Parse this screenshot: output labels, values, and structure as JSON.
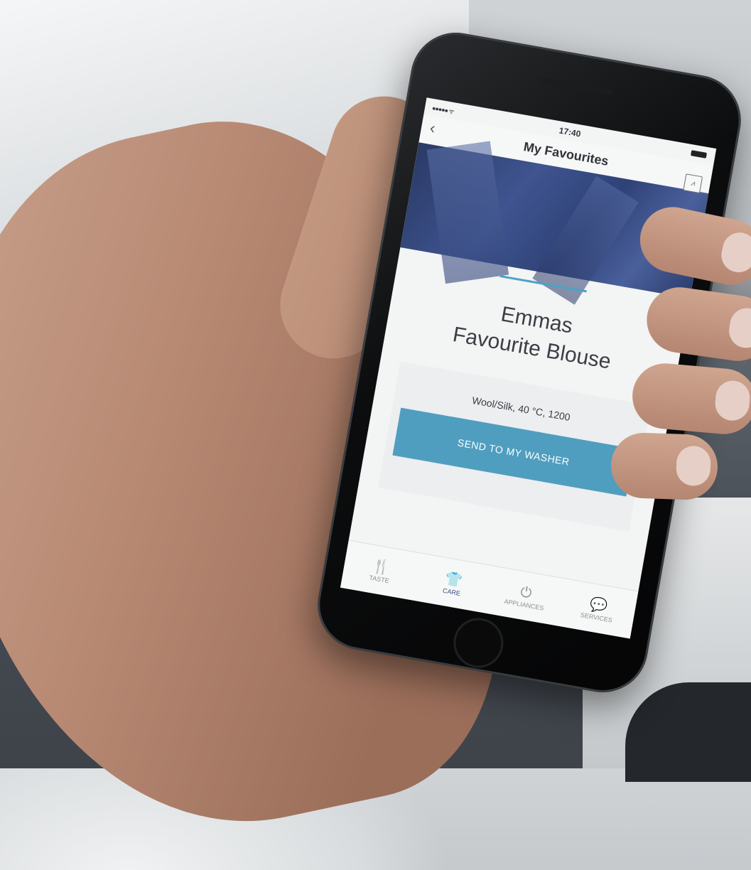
{
  "status_bar": {
    "signal": "●●●●● ᯤ",
    "time": "17:40"
  },
  "header": {
    "back_icon": "‹",
    "title": "My Favourites",
    "action_icon": "activity-icon",
    "action_glyph": "⩘"
  },
  "item": {
    "name_line1": "Emmas",
    "name_line2": "Favourite Blouse",
    "settings": "Wool/Silk, 40 °C, 1200",
    "button_label": "SEND TO MY WASHER"
  },
  "tabs": [
    {
      "label": "TASTE",
      "icon": "fork-knife-icon",
      "glyph": "🍴"
    },
    {
      "label": "CARE",
      "icon": "shirt-icon",
      "glyph": "👕"
    },
    {
      "label": "APPLIANCES",
      "icon": "power-icon",
      "glyph": "⏻"
    },
    {
      "label": "SERVICES",
      "icon": "chat-icon",
      "glyph": "💬"
    }
  ],
  "colors": {
    "accent": "#4aa3c7",
    "button": "#4f9ebf",
    "active_tab": "#3b4f86"
  }
}
